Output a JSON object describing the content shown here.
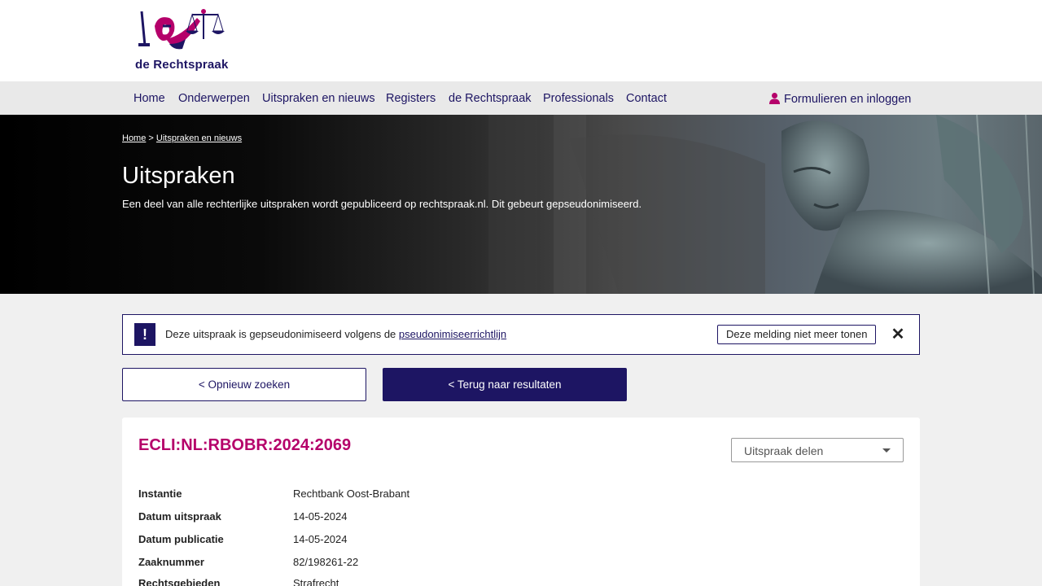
{
  "header": {
    "logo_text": "de Rechtspraak"
  },
  "nav": {
    "items": [
      {
        "label": "Home"
      },
      {
        "label": "Onderwerpen"
      },
      {
        "label": "Uitspraken en nieuws"
      },
      {
        "label": "Registers"
      },
      {
        "label": "de Rechtspraak"
      },
      {
        "label": "Professionals"
      },
      {
        "label": "Contact"
      }
    ],
    "login_label": "Formulieren en inloggen",
    "login_icon": "user-icon"
  },
  "hero": {
    "breadcrumb": {
      "home": "Home",
      "separator": ">",
      "current": "Uitspraken en nieuws"
    },
    "title": "Uitspraken",
    "subtitle": "Een deel van alle rechterlijke uitspraken wordt gepubliceerd op rechtspraak.nl. Dit gebeurt gepseudonimiseerd."
  },
  "notice": {
    "icon_symbol": "!",
    "text": "Deze uitspraak is gepseudonimiseerd volgens de",
    "link_text": "pseudonimiseerrichtlijn",
    "dismiss_label": "Deze melding niet meer tonen",
    "close_symbol": "✕"
  },
  "buttons": {
    "search_again": "< Opnieuw zoeken",
    "back_to_results": "< Terug naar resultaten"
  },
  "ruling": {
    "ecli": "ECLI:NL:RBOBR:2024:2069",
    "share_label": "Uitspraak delen",
    "metadata": [
      {
        "label": "Instantie",
        "value": "Rechtbank Oost-Brabant"
      },
      {
        "label": "Datum uitspraak",
        "value": "14-05-2024"
      },
      {
        "label": "Datum publicatie",
        "value": "14-05-2024"
      },
      {
        "label": "Zaaknummer",
        "value": "82/198261-22"
      },
      {
        "label": "Rechtsgebieden",
        "value": "Strafrecht"
      }
    ]
  },
  "colors": {
    "brand_navy": "#1d1563",
    "brand_magenta": "#b5006a",
    "page_background": "#f0f0f0"
  }
}
